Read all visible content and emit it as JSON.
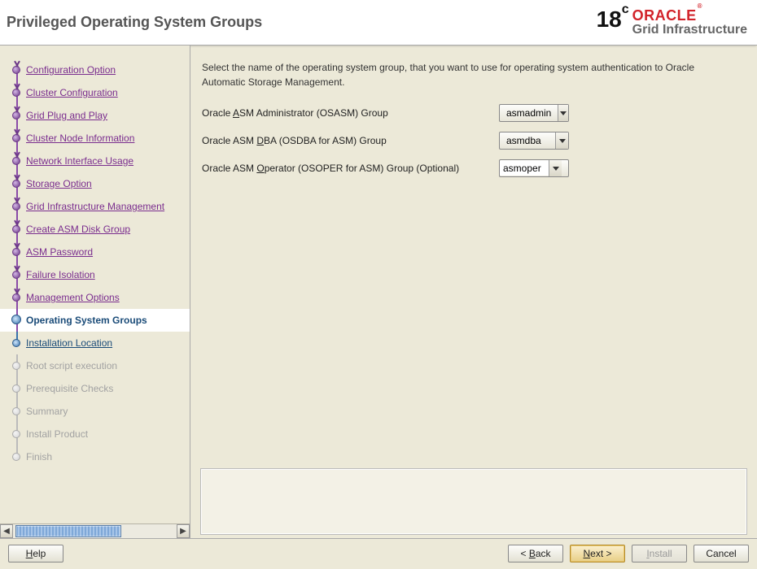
{
  "header": {
    "title": "Privileged Operating System Groups",
    "logo_version": "18",
    "logo_version_suffix": "c",
    "logo_brand": "ORACLE",
    "logo_reg": "®",
    "logo_subtitle": "Grid Infrastructure"
  },
  "sidebar": {
    "steps": [
      {
        "label": "Configuration Option",
        "state": "completed"
      },
      {
        "label": "Cluster Configuration",
        "state": "completed"
      },
      {
        "label": "Grid Plug and Play",
        "state": "completed"
      },
      {
        "label": "Cluster Node Information",
        "state": "completed"
      },
      {
        "label": "Network Interface Usage",
        "state": "completed"
      },
      {
        "label": "Storage Option",
        "state": "completed"
      },
      {
        "label": "Grid Infrastructure Management",
        "state": "completed"
      },
      {
        "label": "Create ASM Disk Group",
        "state": "completed"
      },
      {
        "label": "ASM Password",
        "state": "completed"
      },
      {
        "label": "Failure Isolation",
        "state": "completed"
      },
      {
        "label": "Management Options",
        "state": "completed"
      },
      {
        "label": "Operating System Groups",
        "state": "current"
      },
      {
        "label": "Installation Location",
        "state": "pending"
      },
      {
        "label": "Root script execution",
        "state": "disabled"
      },
      {
        "label": "Prerequisite Checks",
        "state": "disabled"
      },
      {
        "label": "Summary",
        "state": "disabled"
      },
      {
        "label": "Install Product",
        "state": "disabled"
      },
      {
        "label": "Finish",
        "state": "disabled"
      }
    ],
    "scroll_left": "◀",
    "scroll_right": "▶"
  },
  "content": {
    "description": "Select the name of the operating system group, that you want to use for operating system authentication to Oracle Automatic Storage Management.",
    "fields": [
      {
        "label_pre": "Oracle ",
        "label_mnemonic": "A",
        "label_post": "SM Administrator (OSASM) Group",
        "value": "asmadmin",
        "editable": false
      },
      {
        "label_pre": "Oracle ASM ",
        "label_mnemonic": "D",
        "label_post": "BA (OSDBA for ASM) Group",
        "value": "asmdba",
        "editable": false
      },
      {
        "label_pre": "Oracle ASM ",
        "label_mnemonic": "O",
        "label_post": "perator (OSOPER for ASM) Group (Optional)",
        "value": "asmoper",
        "editable": true
      }
    ]
  },
  "footer": {
    "help_pre": "",
    "help_mnemonic": "H",
    "help_post": "elp",
    "back_pre": "< ",
    "back_mnemonic": "B",
    "back_post": "ack",
    "next_pre": "",
    "next_mnemonic": "N",
    "next_post": "ext >",
    "install_pre": "",
    "install_mnemonic": "I",
    "install_post": "nstall",
    "cancel": "Cancel"
  }
}
